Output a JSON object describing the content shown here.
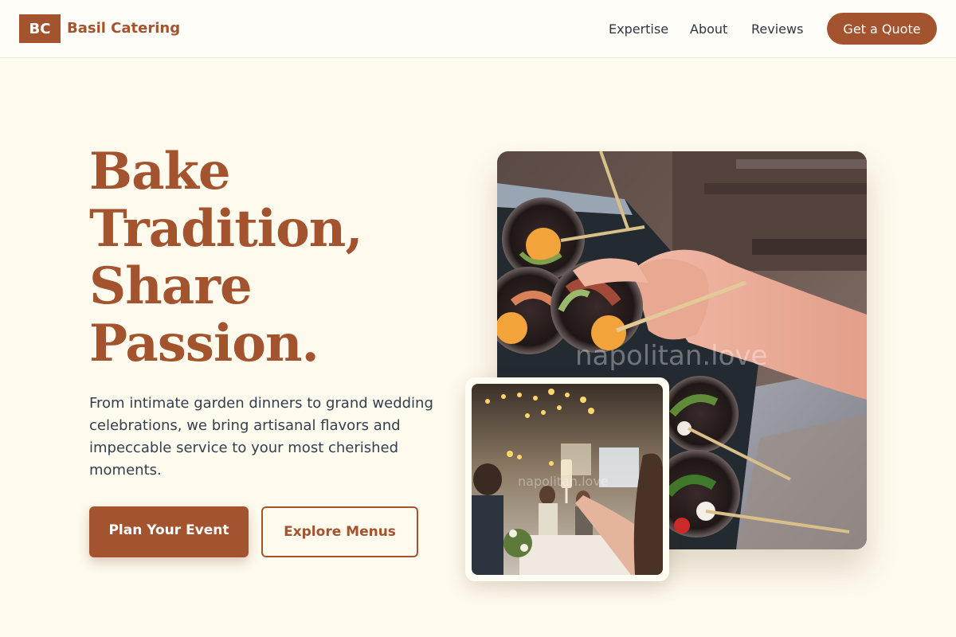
{
  "header": {
    "logo_text": "BC",
    "brand_name": "Basil Catering",
    "nav": [
      "Expertise",
      "About",
      "Reviews"
    ],
    "cta_label": "Get a Quote"
  },
  "hero": {
    "title_lines": [
      "Bake",
      "Tradition,",
      "Share",
      "Passion."
    ],
    "description": "From intimate garden dinners to grand wedding celebrations, we bring artisanal flavors and impeccable service to your most cherished moments.",
    "primary_button": "Plan Your Event",
    "secondary_button": "Explore Menus"
  },
  "images": {
    "main_watermark": "napolitan.love",
    "inset_watermark": "napolitan.love"
  },
  "colors": {
    "brand": "#a3542f",
    "page_background": "#fefaee",
    "header_background": "#fffdf8",
    "body_text": "#34404f"
  }
}
